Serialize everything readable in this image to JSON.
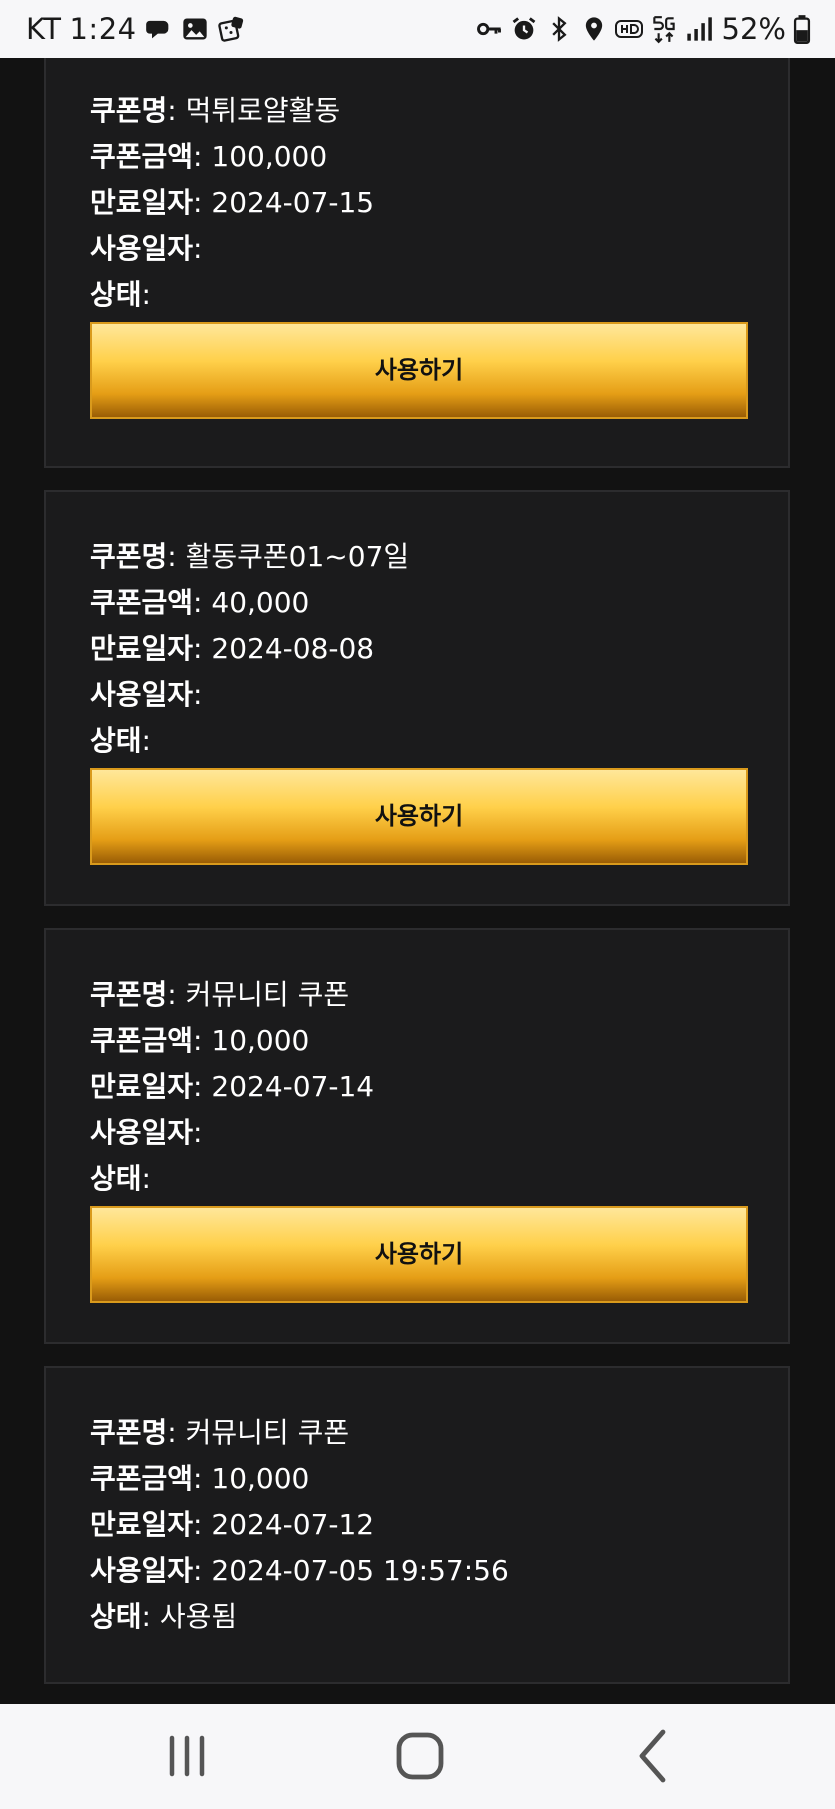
{
  "status_bar": {
    "carrier": "KT",
    "time": "1:24",
    "battery": "52%",
    "left_icons": [
      "chat-bubble-icon",
      "gallery-icon",
      "dice-app-icon"
    ],
    "right_icons": [
      "key-icon",
      "alarm-icon",
      "bluetooth-icon",
      "location-icon",
      "hd-icon",
      "5g-icon",
      "signal-icon",
      "battery-icon"
    ]
  },
  "labels": {
    "name": "쿠폰명",
    "amount": "쿠폰금액",
    "expiry": "만료일자",
    "used_date": "사용일자",
    "status": "상태",
    "separator": ":"
  },
  "coupons": [
    {
      "name": "먹튀로얄활동",
      "amount": "100,000",
      "expiry": "2024-07-15",
      "used_date": "",
      "status": "",
      "button_label": "사용하기"
    },
    {
      "name": "활동쿠폰01~07일",
      "amount": "40,000",
      "expiry": "2024-08-08",
      "used_date": "",
      "status": "",
      "button_label": "사용하기"
    },
    {
      "name": "커뮤니티 쿠폰",
      "amount": "10,000",
      "expiry": "2024-07-14",
      "used_date": "",
      "status": "",
      "button_label": "사용하기"
    },
    {
      "name": "커뮤니티 쿠폰",
      "amount": "10,000",
      "expiry": "2024-07-12",
      "used_date": "2024-07-05 19:57:56",
      "status": "사용됨"
    }
  ],
  "nav": {
    "icons": [
      "recent-apps-icon",
      "home-icon",
      "back-icon"
    ]
  },
  "colors": {
    "background": "#121212",
    "card": "#1b1b1c",
    "card_border": "#2c2c2e",
    "button_gold_top": "#ffe79a",
    "button_gold_bottom": "#9a5d05",
    "button_border": "#d99a1c",
    "text": "#ffffff"
  }
}
